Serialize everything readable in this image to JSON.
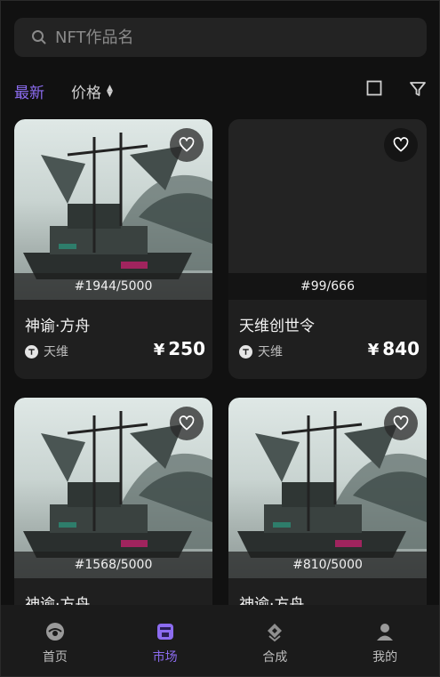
{
  "search": {
    "placeholder": "NFT作品名"
  },
  "sort": {
    "latest": "最新",
    "price": "价格"
  },
  "products": [
    {
      "name": "神谕·方舟",
      "creator": "天维",
      "price": "250",
      "edition": "#1944/5000",
      "has_image": true
    },
    {
      "name": "天维创世令",
      "creator": "天维",
      "price": "840",
      "edition": "#99/666",
      "has_image": false
    },
    {
      "name": "神谕·方舟",
      "creator": "",
      "price": "",
      "edition": "#1568/5000",
      "has_image": true
    },
    {
      "name": "神谕·方舟",
      "creator": "",
      "price": "",
      "edition": "#810/5000",
      "has_image": true
    }
  ],
  "currency": "¥",
  "tabs": [
    {
      "label": "首页",
      "icon": "home-icon"
    },
    {
      "label": "市场",
      "icon": "market-icon",
      "active": true
    },
    {
      "label": "合成",
      "icon": "synthesis-icon"
    },
    {
      "label": "我的",
      "icon": "profile-icon"
    }
  ],
  "colors": {
    "accent": "#8c6cf0",
    "background": "#111111",
    "card": "#1f1f1f"
  }
}
